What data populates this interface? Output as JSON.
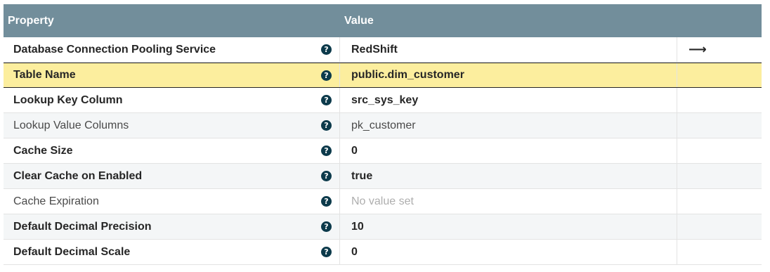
{
  "header": {
    "property_label": "Property",
    "value_label": "Value"
  },
  "rows": [
    {
      "property": "Database Connection Pooling Service",
      "value": "RedShift",
      "action_icon": "go-to-arrow-icon"
    },
    {
      "property": "Table Name",
      "value": "public.dim_customer"
    },
    {
      "property": "Lookup Key Column",
      "value": "src_sys_key"
    },
    {
      "property": "Lookup Value Columns",
      "value": "pk_customer"
    },
    {
      "property": "Cache Size",
      "value": "0"
    },
    {
      "property": "Clear Cache on Enabled",
      "value": "true"
    },
    {
      "property": "Cache Expiration",
      "value": "No value set"
    },
    {
      "property": "Default Decimal Precision",
      "value": "10"
    },
    {
      "property": "Default Decimal Scale",
      "value": "0"
    }
  ],
  "help_glyph": "?",
  "arrow_glyph": "⟶",
  "colors": {
    "header_bg": "#728e9b",
    "selected_row_bg": "#fcee9e",
    "help_icon_bg": "#0c3a4b",
    "unset_value_text": "#aeaeae"
  }
}
